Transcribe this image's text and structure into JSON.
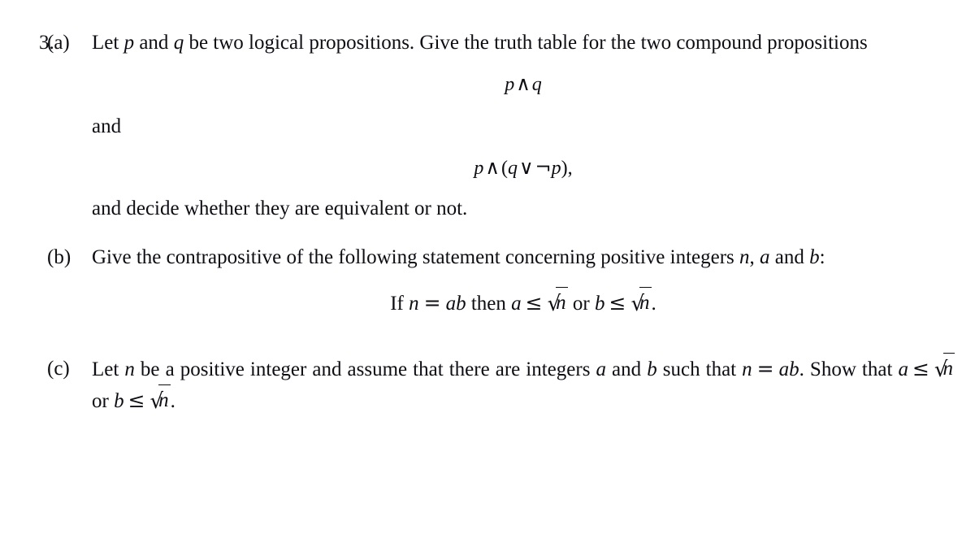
{
  "document": {
    "type": "math-exercise",
    "background_color": "#ffffff",
    "text_color": "#0d0d14",
    "problem_number": "3.",
    "parts": [
      {
        "label": "(a)",
        "lines": [
          "Let p and q be two logical propositions. Give the truth table for the two compound propositions",
          "and",
          "and decide whether they are equivalent or not."
        ],
        "display_math": [
          "p ∧ q",
          "p ∧ (q ∨ ¬p),"
        ]
      },
      {
        "label": "(b)",
        "lines": [
          "Give the contrapositive of the following statement concerning positive integers n, a and b:"
        ],
        "display_math": [
          "If n = ab then a ≤ √n or b ≤ √n."
        ]
      },
      {
        "label": "(c)",
        "lines": [
          "Let n be a positive integer and assume that there are integers a and b such that n = ab. Show that a ≤ √n or b ≤ √n."
        ],
        "display_math": []
      }
    ]
  },
  "content": {
    "problem_number": "3.",
    "part_a": {
      "label": "(a)",
      "text_1_a": "Let ",
      "text_1_b": " and ",
      "text_1_c": " be two logical propositions. Give the truth table for the two compound propositions",
      "var_p": "p",
      "var_q": "q",
      "formula_1": "p ∧ q",
      "connector": "and",
      "formula_2": "p ∧ (q ∨ ¬p),",
      "text_2": "and decide whether they are equivalent or not."
    },
    "part_b": {
      "label": "(b)",
      "text_1": "Give the contrapositive of the following statement concerning positive integers ",
      "var_n": "n",
      "comma": ", ",
      "var_a": "a",
      "text_and": " and ",
      "var_b": "b",
      "colon": ":",
      "statement_if": "If ",
      "statement_eq": "=",
      "statement_ab": "ab",
      "statement_then": " then ",
      "statement_or": " or ",
      "statement_le": "≤",
      "statement_period": "."
    },
    "part_c": {
      "label": "(c)",
      "t1": "Let ",
      "t2": " be a positive integer and assume that there are integers ",
      "t3": " and ",
      "t4": "such that ",
      "t5": ". Show that ",
      "t6": " or ",
      "var_n": "n",
      "var_a": "a",
      "var_b": "b",
      "eq": "=",
      "ab": "ab",
      "le": "≤",
      "period": "."
    },
    "symbols": {
      "wedge": "∧",
      "vee": "∨",
      "neg": "¬",
      "leq": "≤",
      "radical": "√",
      "equals": "="
    }
  }
}
